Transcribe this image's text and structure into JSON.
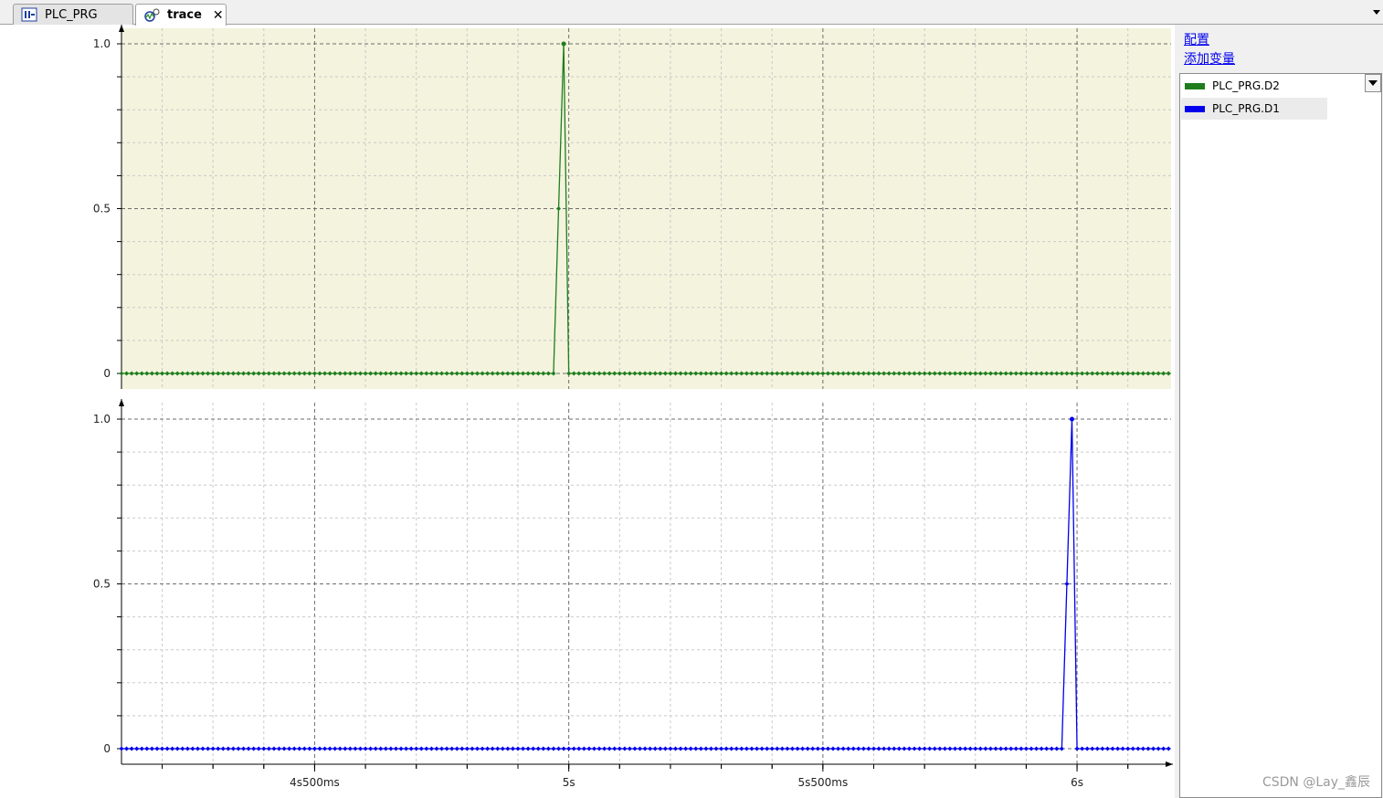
{
  "tabs": [
    {
      "label": "PLC_PRG",
      "icon": "program-icon",
      "active": false
    },
    {
      "label": "trace",
      "icon": "trace-icon",
      "active": true,
      "closable": true
    }
  ],
  "side_panel": {
    "config_link": "配置",
    "add_variable_link": "添加变量",
    "variables": [
      {
        "label": "PLC_PRG.D2",
        "color": "#1e7e1e"
      },
      {
        "label": "PLC_PRG.D1",
        "color": "#0000ee"
      }
    ]
  },
  "watermark": "CSDN @Lay_鑫辰",
  "colors": {
    "top_plot_background": "#f4f3dd",
    "bottom_plot_background": "#ffffff",
    "series_d2": "#1e7e1e",
    "series_d1": "#0000ee"
  },
  "chart_data": {
    "type": "line",
    "x_unit": "ms",
    "x_range": [
      4120,
      6185
    ],
    "x_major_ticks": [
      {
        "value": 4500,
        "label": "4s500ms"
      },
      {
        "value": 5000,
        "label": "5s"
      },
      {
        "value": 5500,
        "label": "5s500ms"
      },
      {
        "value": 6000,
        "label": "6s"
      }
    ],
    "x_minor_step": 100,
    "y_ticks": [
      {
        "value": 0,
        "label": "0"
      },
      {
        "value": 0.5,
        "label": "0.5"
      },
      {
        "value": 1.0,
        "label": "1.0"
      }
    ],
    "ylim": [
      0,
      1.0
    ],
    "grid": true,
    "sample_interval": 10,
    "panels": [
      {
        "series": [
          {
            "name": "PLC_PRG.D2",
            "color": "#1e7e1e",
            "pulse": {
              "start": 4970,
              "peak": 4990,
              "end": 5000
            }
          }
        ]
      },
      {
        "series": [
          {
            "name": "PLC_PRG.D1",
            "color": "#0000ee",
            "pulse": {
              "start": 5970,
              "peak": 5990,
              "end": 6000
            }
          }
        ]
      }
    ]
  }
}
